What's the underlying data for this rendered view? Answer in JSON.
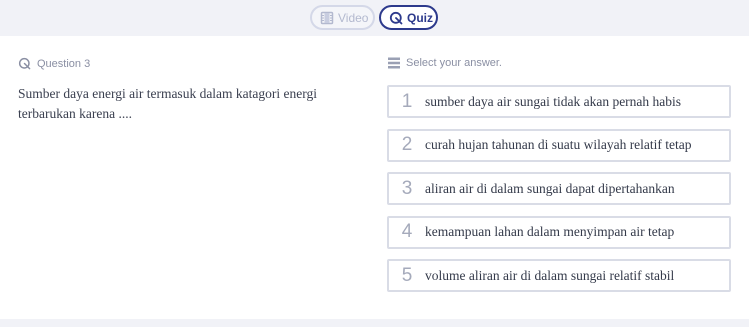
{
  "tabs": {
    "video_label": "Video",
    "quiz_label": "Quiz"
  },
  "question": {
    "header": "Question 3",
    "text": "Sumber daya energi air termasuk dalam katagori energi terbarukan karena ...."
  },
  "answers": {
    "header": "Select your answer.",
    "options": [
      {
        "number": "1",
        "text": "sumber daya air sungai tidak akan pernah habis"
      },
      {
        "number": "2",
        "text": "curah hujan tahunan di suatu wilayah relatif tetap"
      },
      {
        "number": "3",
        "text": "aliran air di dalam sungai dapat dipertahankan"
      },
      {
        "number": "4",
        "text": "kemampuan lahan dalam menyimpan air tetap"
      },
      {
        "number": "5",
        "text": "volume aliran air di dalam sungai relatif stabil"
      }
    ]
  },
  "icons": {
    "video": "film-icon",
    "quiz": "quiz-icon",
    "question": "quiz-icon",
    "answers": "list-icon"
  },
  "colors": {
    "accent": "#2d3a8c",
    "muted": "#b3b9cf",
    "background": "#f1f2f7"
  }
}
